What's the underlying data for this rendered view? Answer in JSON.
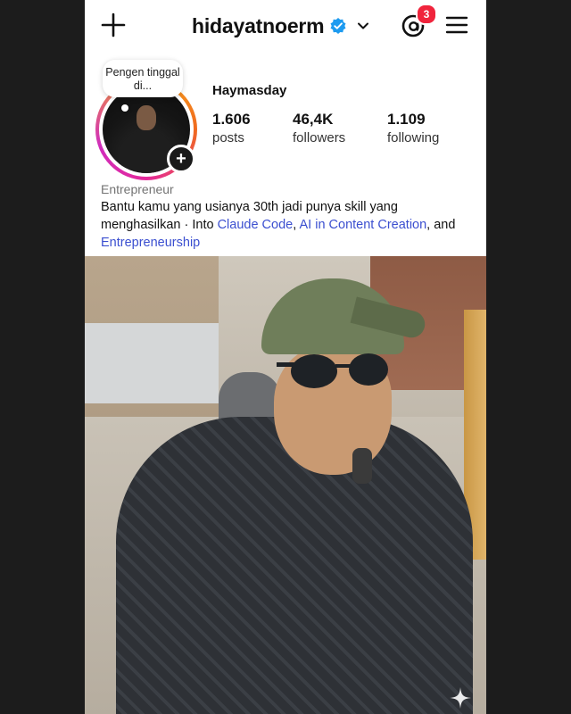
{
  "header": {
    "username": "hidayatnoerm",
    "notification_count": "3"
  },
  "profile": {
    "note_text": "Pengen tinggal di...",
    "display_name": "Haymasday",
    "stats": [
      {
        "value": "1.606",
        "label": "posts"
      },
      {
        "value": "46,4K",
        "label": "followers"
      },
      {
        "value": "1.109",
        "label": "following"
      }
    ],
    "category": "Entrepreneur",
    "bio_text": "Bantu kamu yang usianya 30th jadi punya skill yang menghasilkan · Into ",
    "bio_links": [
      "Claude Code",
      "AI in Content Creation",
      "Entrepreneurship"
    ],
    "bio_sep": ", ",
    "bio_and": ", and "
  },
  "colors": {
    "accent_link": "#3b4fd0",
    "badge": "#f0243c",
    "verified": "#1d9bf0"
  },
  "icons": [
    "plus-icon",
    "verified-icon",
    "chevron-down-icon",
    "threads-icon",
    "hamburger-menu-icon",
    "sparkle-icon"
  ]
}
